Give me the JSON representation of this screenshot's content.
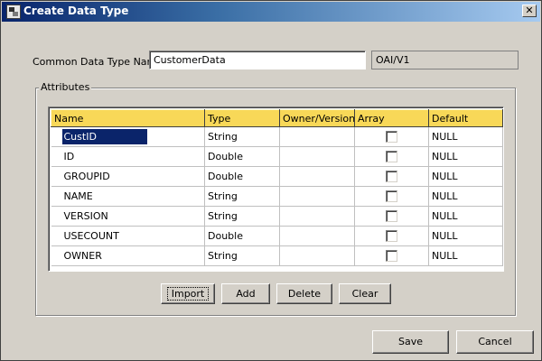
{
  "window": {
    "title": "Create Data Type"
  },
  "form": {
    "name_label": "Common Data Type Name:",
    "name_value": "CustomerData",
    "version_value": "OAI/V1"
  },
  "attributes": {
    "group_label": "Attributes",
    "columns": [
      "Name",
      "Type",
      "Owner/Version",
      "Array",
      "Default"
    ],
    "rows": [
      {
        "name": "CustID",
        "type": "String",
        "owner": "",
        "array": false,
        "default": "NULL"
      },
      {
        "name": "ID",
        "type": "Double",
        "owner": "",
        "array": false,
        "default": "NULL"
      },
      {
        "name": "GROUPID",
        "type": "Double",
        "owner": "",
        "array": false,
        "default": "NULL"
      },
      {
        "name": "NAME",
        "type": "String",
        "owner": "",
        "array": false,
        "default": "NULL"
      },
      {
        "name": "VERSION",
        "type": "String",
        "owner": "",
        "array": false,
        "default": "NULL"
      },
      {
        "name": "USECOUNT",
        "type": "Double",
        "owner": "",
        "array": false,
        "default": "NULL"
      },
      {
        "name": "OWNER",
        "type": "String",
        "owner": "",
        "array": false,
        "default": "NULL"
      }
    ],
    "buttons": {
      "import": "Import",
      "add": "Add",
      "delete": "Delete",
      "clear": "Clear"
    }
  },
  "dialog_buttons": {
    "save": "Save",
    "cancel": "Cancel"
  }
}
